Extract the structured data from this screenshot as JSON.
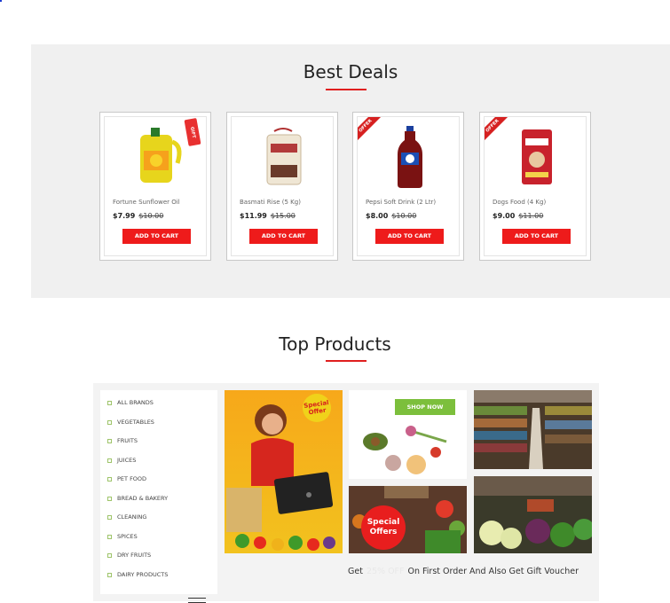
{
  "best_deals": {
    "title": "Best Deals",
    "products": [
      {
        "name": "Fortune Sunflower Oil",
        "price": "$7.99",
        "old_price": "$10.00",
        "button": "ADD TO CART",
        "badge": "GIFT",
        "image": "oil-bottle-icon"
      },
      {
        "name": "Basmati Rise (5 Kg)",
        "price": "$11.99",
        "old_price": "$15.00",
        "button": "ADD TO CART",
        "badge": "",
        "image": "rice-bag-icon"
      },
      {
        "name": "Pepsi Soft Drink (2 Ltr)",
        "price": "$8.00",
        "old_price": "$10.00",
        "button": "ADD TO CART",
        "badge": "OFFER",
        "image": "soda-bottle-icon"
      },
      {
        "name": "Dogs Food (4 Kg)",
        "price": "$9.00",
        "old_price": "$11.00",
        "button": "ADD TO CART",
        "badge": "OFFER",
        "image": "dog-food-bag-icon"
      }
    ]
  },
  "top_products": {
    "title": "Top Products",
    "categories": [
      "ALL BRANDS",
      "VEGETABLES",
      "FRUITS",
      "JUICES",
      "PET FOOD",
      "BREAD & BAKERY",
      "CLEANING",
      "SPICES",
      "DRY FRUITS",
      "DAIRY PRODUCTS"
    ],
    "banner_special": "Special Offer",
    "shop_now": "SHOP NOW",
    "special_offers": [
      "Special",
      "Offers"
    ],
    "promo": {
      "prefix": "Get",
      "hidden": "25% OFF",
      "suffix": "On First Order And Also Get Gift Voucher"
    }
  },
  "colors": {
    "accent": "#e01f1f",
    "button": "#ee1b1b",
    "shop_now": "#7cbf3c",
    "section_bg": "#f0f0f0"
  }
}
